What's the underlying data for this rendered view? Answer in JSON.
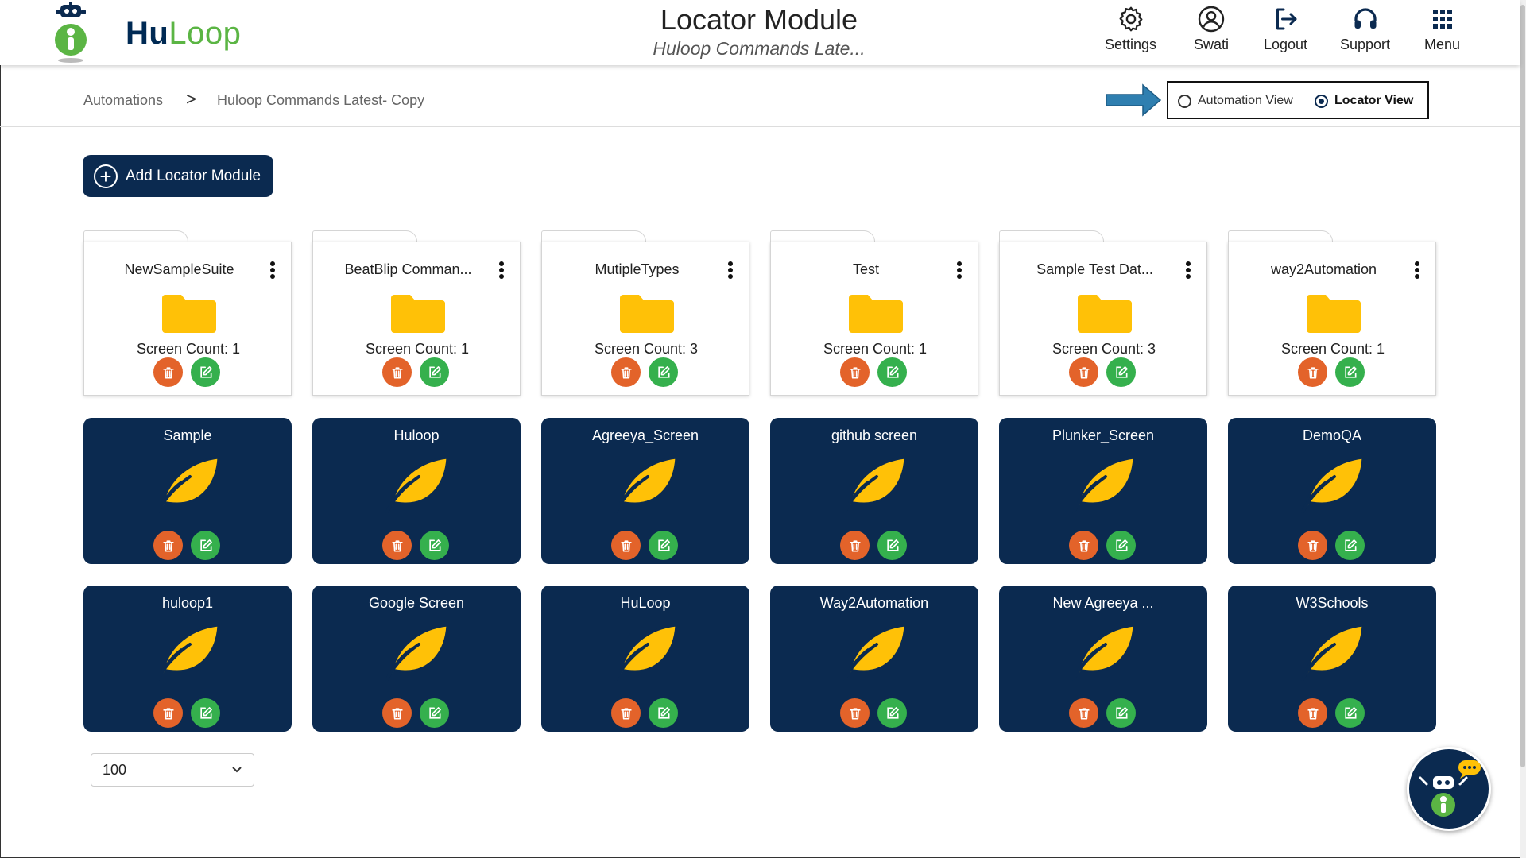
{
  "header": {
    "logo": {
      "hu": "Hu",
      "loop": "Loop"
    },
    "title": "Locator Module",
    "subtitle": "Huloop Commands Late...",
    "nav": [
      {
        "label": "Settings",
        "icon": "gear-icon"
      },
      {
        "label": "Swati",
        "icon": "user-icon"
      },
      {
        "label": "Logout",
        "icon": "logout-icon"
      },
      {
        "label": "Support",
        "icon": "headset-icon"
      },
      {
        "label": "Menu",
        "icon": "grid-icon"
      }
    ]
  },
  "breadcrumb": {
    "items": [
      "Automations",
      "Huloop Commands Latest- Copy"
    ],
    "separator": ">"
  },
  "view_toggle": {
    "options": [
      "Automation View",
      "Locator View"
    ],
    "selected": "Locator View"
  },
  "add_button": {
    "label": "Add Locator Module"
  },
  "folder_prefix": "Screen Count: ",
  "folders": [
    {
      "name": "NewSampleSuite",
      "count": "1"
    },
    {
      "name": "BeatBlip Comman...",
      "count": "1"
    },
    {
      "name": "MutipleTypes",
      "count": "3"
    },
    {
      "name": "Test",
      "count": "1"
    },
    {
      "name": "Sample Test Dat...",
      "count": "3"
    },
    {
      "name": "way2Automation",
      "count": "1"
    }
  ],
  "screens": [
    "Sample",
    "Huloop",
    "Agreeya_Screen",
    "github screen",
    "Plunker_Screen",
    "DemoQA",
    "huloop1",
    "Google Screen",
    "HuLoop",
    "Way2Automation",
    "New Agreeya ...",
    "W3Schools"
  ],
  "page_size": {
    "value": "100"
  },
  "colors": {
    "navy": "#0b2a50",
    "folder_yellow": "#ffc107",
    "delete_orange": "#e3632a",
    "edit_green": "#35b04d",
    "logo_green": "#5bb544"
  }
}
